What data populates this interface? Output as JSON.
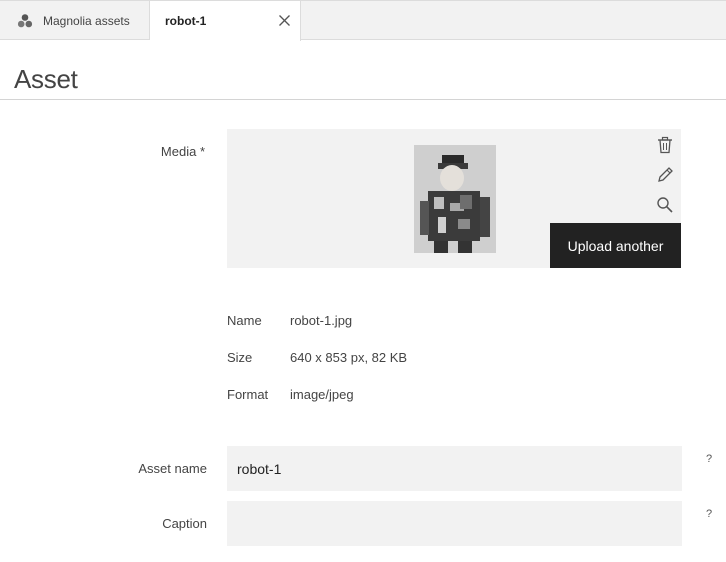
{
  "tabs": [
    {
      "label": "Magnolia assets",
      "icon": "magnolia-assets-icon"
    },
    {
      "label": "robot-1",
      "icon": "close-icon"
    }
  ],
  "page": {
    "title": "Asset"
  },
  "media": {
    "label": "Media *",
    "thumbnail": "robot-thumbnail",
    "icons": [
      "trash-icon",
      "pencil-icon",
      "search-icon"
    ],
    "upload_label": "Upload another"
  },
  "file_info": {
    "name_key": "Name",
    "name_value": "robot-1.jpg",
    "size_key": "Size",
    "size_value": "640 x 853 px, 82 KB",
    "format_key": "Format",
    "format_value": "image/jpeg"
  },
  "form": {
    "asset_name_label": "Asset name",
    "asset_name_value": "robot-1",
    "caption_label": "Caption",
    "caption_value": "",
    "help_symbol": "?"
  },
  "colors": {
    "upload_button_bg": "#222222",
    "field_bg": "#f2f2f2",
    "tabbar_bg": "#f2f2f2"
  }
}
